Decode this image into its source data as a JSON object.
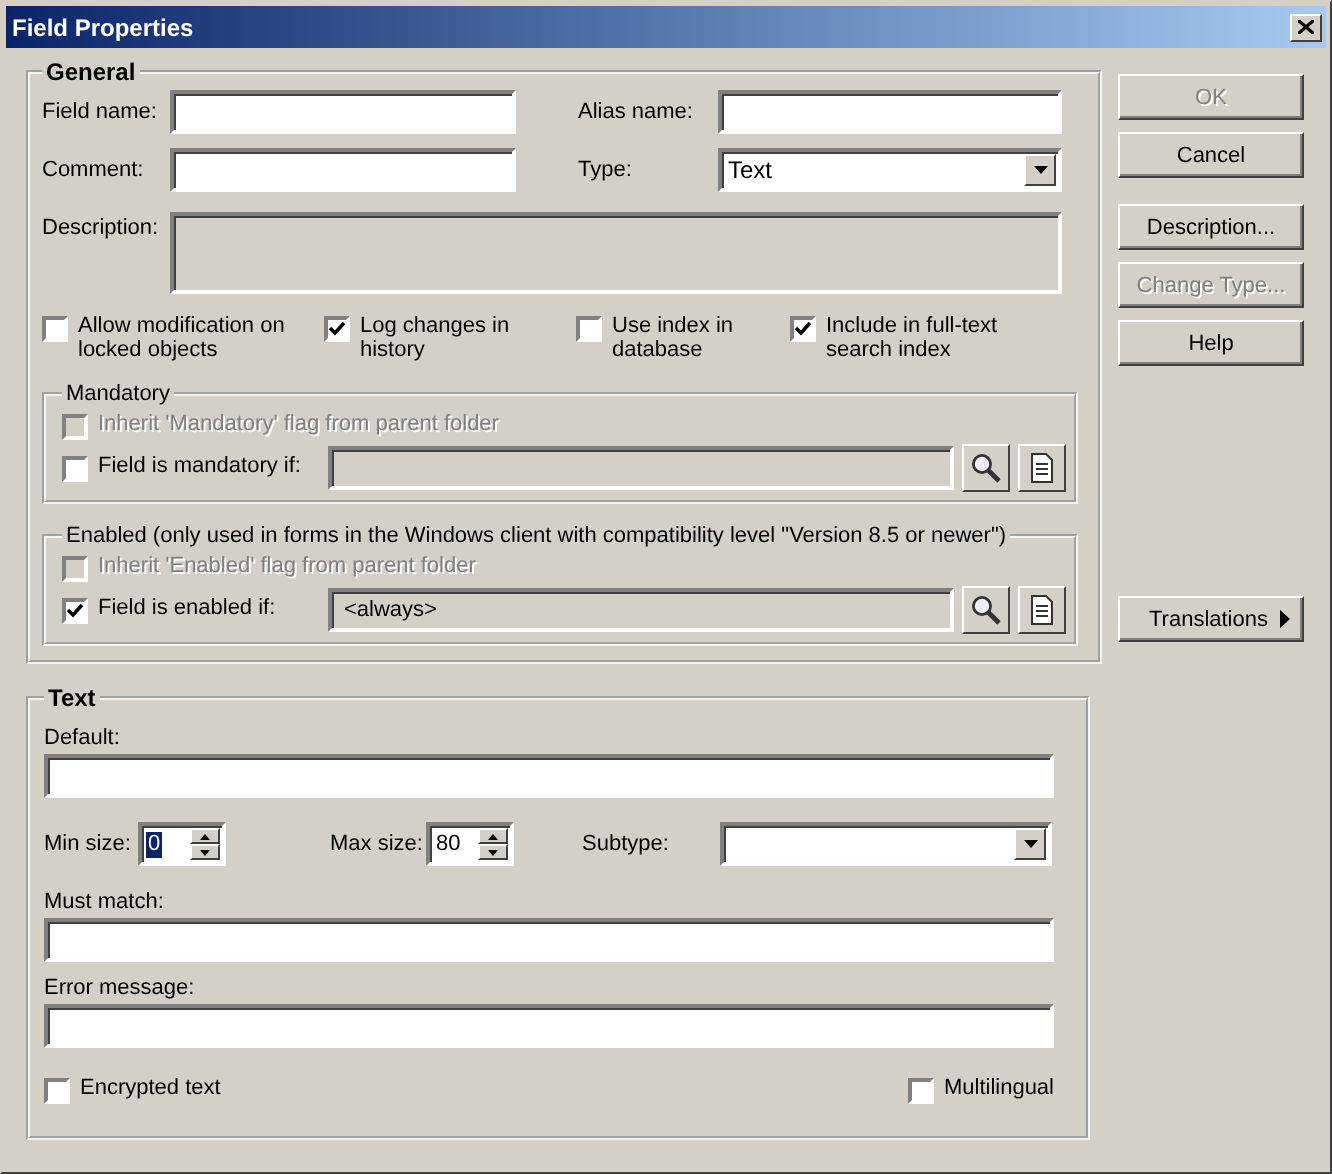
{
  "window": {
    "title": "Field Properties"
  },
  "general": {
    "title": "General",
    "fields": [
      {
        "label": "Field name:",
        "kind": "input"
      },
      {
        "label": "Alias name:",
        "kind": "input"
      },
      {
        "label": "Comment:",
        "kind": "input"
      },
      {
        "label": "Type:",
        "kind": "select",
        "value": "Text"
      }
    ],
    "description": {
      "label": "Description:",
      "disabled": true
    },
    "options": [
      {
        "label": "Allow modification on locked objects",
        "checked": false
      },
      {
        "label": "Log changes in history",
        "checked": true
      },
      {
        "label": "Use index in database",
        "checked": false
      },
      {
        "label": "Include in full-text search index",
        "checked": true
      }
    ],
    "subgroups": [
      {
        "title": "Mandatory",
        "inherit": {
          "label": "Inherit 'Mandatory' flag from parent folder",
          "checked": false,
          "disabled": true
        },
        "condition": {
          "label": "Field is mandatory if:",
          "checked": false
        }
      },
      {
        "title": "Enabled (only used in forms in the Windows client with compatibility level \"Version 8.5 or newer\")",
        "inherit": {
          "label": "Inherit 'Enabled' flag from parent folder",
          "checked": false,
          "disabled": true
        },
        "condition": {
          "label": "Field is enabled if:",
          "checked": true,
          "value": "<always>"
        }
      }
    ]
  },
  "text": {
    "title": "Text",
    "default": {
      "label": "Default:"
    },
    "sizes": [
      {
        "label": "Min size:",
        "value": "0",
        "highlighted": true
      },
      {
        "label": "Max size:",
        "value": "80",
        "highlighted": false
      }
    ],
    "subtype": {
      "label": "Subtype:"
    },
    "must_match": {
      "label": "Must match:"
    },
    "error_message": {
      "label": "Error message:"
    },
    "checks": [
      {
        "label": "Encrypted text",
        "checked": false
      },
      {
        "label": "Multilingual",
        "checked": false
      }
    ]
  },
  "buttons": [
    {
      "label": "OK",
      "disabled": true
    },
    {
      "label": "Cancel",
      "disabled": false
    },
    {
      "label": "Description...",
      "disabled": false
    },
    {
      "label": "Change Type...",
      "disabled": true
    },
    {
      "label": "Help",
      "disabled": false
    }
  ],
  "translations": {
    "label": "Translations"
  }
}
